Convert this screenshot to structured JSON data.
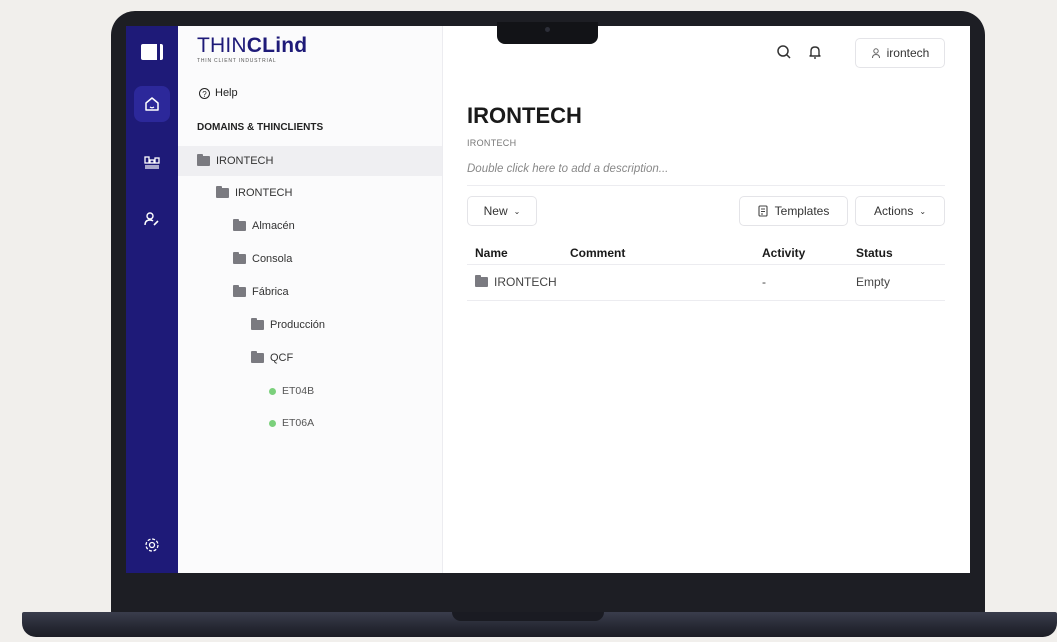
{
  "app": {
    "brand": {
      "prefix": "THIN",
      "highlight": "CLind",
      "tagline": "THIN CLIENT INDUSTRIAL"
    }
  },
  "rail": {
    "items": [
      {
        "icon": "home-icon",
        "active": true
      },
      {
        "icon": "devices-icon",
        "active": false
      },
      {
        "icon": "users-icon",
        "active": false
      },
      {
        "icon": "settings-icon",
        "active": false
      }
    ]
  },
  "header": {
    "user": "irontech",
    "icons": [
      "search-icon",
      "bell-icon",
      "user-icon"
    ]
  },
  "sidebar": {
    "help": "Help",
    "section_title": "DOMAINS & THINCLIENTS",
    "tree": [
      {
        "label": "IRONTECH",
        "type": "folder",
        "level": 0,
        "selected": true
      },
      {
        "label": "IRONTECH",
        "type": "folder",
        "level": 1
      },
      {
        "label": "Almacén",
        "type": "folder",
        "level": 2
      },
      {
        "label": "Consola",
        "type": "folder",
        "level": 2
      },
      {
        "label": "Fábrica",
        "type": "folder",
        "level": 2
      },
      {
        "label": "Producción",
        "type": "folder",
        "level": 3
      },
      {
        "label": "QCF",
        "type": "folder",
        "level": 3
      },
      {
        "label": "ET04B",
        "type": "client",
        "level": 4,
        "status_color": "#7bd07c"
      },
      {
        "label": "ET06A",
        "type": "client",
        "level": 4,
        "status_color": "#7bd07c"
      }
    ]
  },
  "main": {
    "title": "IRONTECH",
    "breadcrumb": "IRONTECH",
    "description_placeholder": "Double click here to add a description...",
    "toolbar": {
      "new_label": "New",
      "templates_label": "Templates",
      "actions_label": "Actions"
    },
    "table": {
      "columns": [
        "Name",
        "Comment",
        "Activity",
        "Status"
      ],
      "rows": [
        {
          "name": "IRONTECH",
          "comment": "",
          "activity": "-",
          "status": "Empty"
        }
      ]
    }
  },
  "colors": {
    "rail": "#1e1a78",
    "brand": "#1e1a78",
    "online": "#7bd07c"
  }
}
